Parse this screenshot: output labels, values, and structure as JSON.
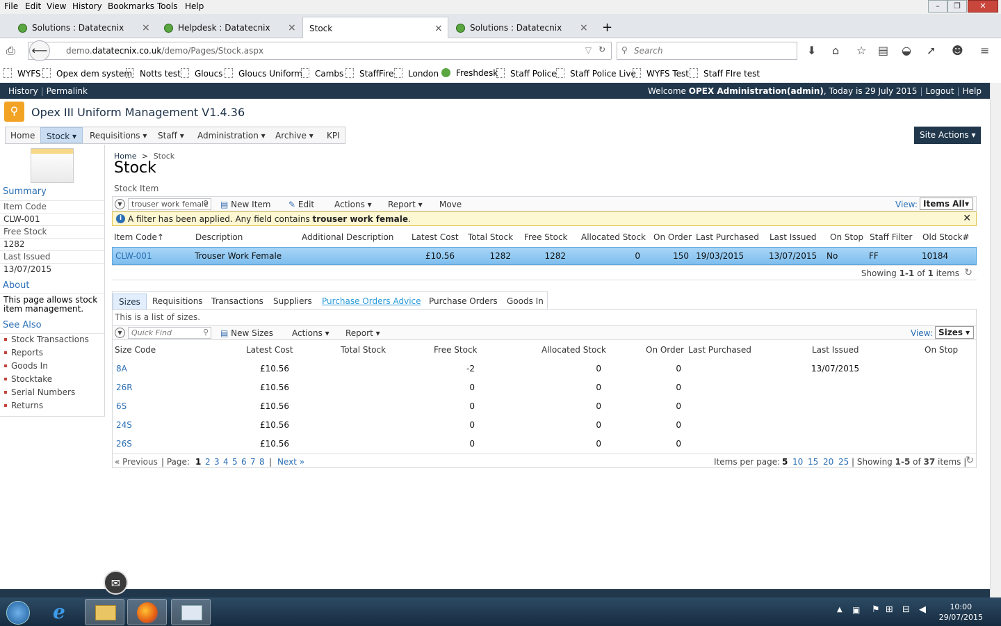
{
  "browser": {
    "menu": [
      "File",
      "Edit",
      "View",
      "History",
      "Bookmarks",
      "Tools",
      "Help"
    ],
    "tabs": [
      {
        "label": "Solutions : Datatecnix"
      },
      {
        "label": "Helpdesk : Datatecnix"
      },
      {
        "label": "Stock"
      },
      {
        "label": "Solutions : Datatecnix"
      }
    ],
    "new_tab": "+",
    "close_glyph": "×",
    "url_prefix": "demo.",
    "url_domain": "datatecnix.co.uk",
    "url_path": "/demo/Pages/Stock.aspx",
    "search_placeholder": "Search",
    "bookmarks": [
      "WYFS",
      "Opex dem system",
      "Notts test",
      "Gloucs",
      "Gloucs Uniform",
      "Cambs",
      "StaffFire",
      "London",
      "Freshdesk",
      "Staff Police",
      "Staff Police Live",
      "WYFS Test",
      "Staff FIre test"
    ]
  },
  "sp": {
    "history": "History",
    "permalink": "Permalink",
    "welcome_pre": "Welcome ",
    "user": "OPEX Administration(admin)",
    "welcome_post": ", Today is 29 July 2015",
    "logout": "Logout",
    "help": "Help",
    "site_title": "Opex III Uniform Management V1.4.36",
    "nav": [
      "Home",
      "Stock",
      "Requisitions",
      "Staff",
      "Administration",
      "Archive",
      "KPI"
    ],
    "site_actions": "Site Actions"
  },
  "left": {
    "summary": "Summary",
    "item_code_label": "Item Code",
    "item_code": "CLW-001",
    "free_stock_label": "Free Stock",
    "free_stock": "1282",
    "last_issued_label": "Last Issued",
    "last_issued": "13/07/2015",
    "about": "About",
    "about_text": "This page allows stock item management.",
    "see_also": "See Also",
    "links": [
      "Stock Transactions",
      "Reports",
      "Goods In",
      "Stocktake",
      "Serial Numbers",
      "Returns"
    ]
  },
  "main": {
    "crumb_home": "Home",
    "crumb_sep": ">",
    "crumb_current": "Stock",
    "title": "Stock",
    "subtitle": "Stock Item",
    "search_value": "trouser work female",
    "toolbar": {
      "new_item": "New Item",
      "edit": "Edit",
      "actions": "Actions",
      "report": "Report",
      "move": "Move",
      "view_label": "View:",
      "view_value": "Items All"
    },
    "filter_text": "A filter has been applied. Any field contains ",
    "filter_term": "trouser work female",
    "headers": [
      "Item Code",
      "Description",
      "Additional Description",
      "Latest Cost",
      "Total Stock",
      "Free Stock",
      "Allocated Stock",
      "On Order",
      "Last Purchased",
      "Last Issued",
      "On Stop",
      "Staff Filter",
      "Old Stock#"
    ],
    "row": {
      "code": "CLW-001",
      "desc": "Trouser Work Female",
      "add_desc": "",
      "cost": "£10.56",
      "total": "1282",
      "free": "1282",
      "alloc": "0",
      "order": "150",
      "last_purchased": "19/03/2015",
      "last_issued": "13/07/2015",
      "on_stop": "No",
      "staff_filter": "FF",
      "old_stock": "10184"
    },
    "showing": {
      "pre": "Showing ",
      "range": "1-1",
      "of": " of ",
      "total": "1",
      "post": " items"
    }
  },
  "sizes": {
    "tabs": [
      "Sizes",
      "Requisitions",
      "Transactions",
      "Suppliers",
      "Purchase Orders Advice",
      "Purchase Orders",
      "Goods In"
    ],
    "desc": "This is a list of sizes.",
    "quick_find": "Quick Find",
    "toolbar": {
      "new": "New Sizes",
      "actions": "Actions",
      "report": "Report",
      "view_label": "View:",
      "view_value": "Sizes"
    },
    "headers": [
      "Size Code",
      "Latest Cost",
      "Total Stock",
      "Free Stock",
      "Allocated Stock",
      "On Order",
      "Last Purchased",
      "Last Issued",
      "On Stop"
    ],
    "rows": [
      {
        "code": "8A",
        "cost": "£10.56",
        "total": "",
        "free": "-2",
        "alloc": "0",
        "order": "0",
        "purchased": "",
        "issued": "13/07/2015",
        "stop": ""
      },
      {
        "code": "26R",
        "cost": "£10.56",
        "total": "",
        "free": "0",
        "alloc": "0",
        "order": "0",
        "purchased": "",
        "issued": "",
        "stop": ""
      },
      {
        "code": "6S",
        "cost": "£10.56",
        "total": "",
        "free": "0",
        "alloc": "0",
        "order": "0",
        "purchased": "",
        "issued": "",
        "stop": ""
      },
      {
        "code": "24S",
        "cost": "£10.56",
        "total": "",
        "free": "0",
        "alloc": "0",
        "order": "0",
        "purchased": "",
        "issued": "",
        "stop": ""
      },
      {
        "code": "26S",
        "cost": "£10.56",
        "total": "",
        "free": "0",
        "alloc": "0",
        "order": "0",
        "purchased": "",
        "issued": "",
        "stop": ""
      }
    ],
    "pager": {
      "prev": "« Previous",
      "page_label": "| Page:",
      "pages": [
        "1",
        "2",
        "3",
        "4",
        "5",
        "6",
        "7",
        "8"
      ],
      "next": "Next »",
      "per_page_label": "Items per page:",
      "per_page": [
        "5",
        "10",
        "15",
        "20",
        "25"
      ],
      "showing_pre": "| Showing ",
      "range": "1-5",
      "of": " of ",
      "total": "37",
      "post": " items |"
    }
  },
  "taskbar": {
    "time": "10:00",
    "date": "29/07/2015"
  }
}
